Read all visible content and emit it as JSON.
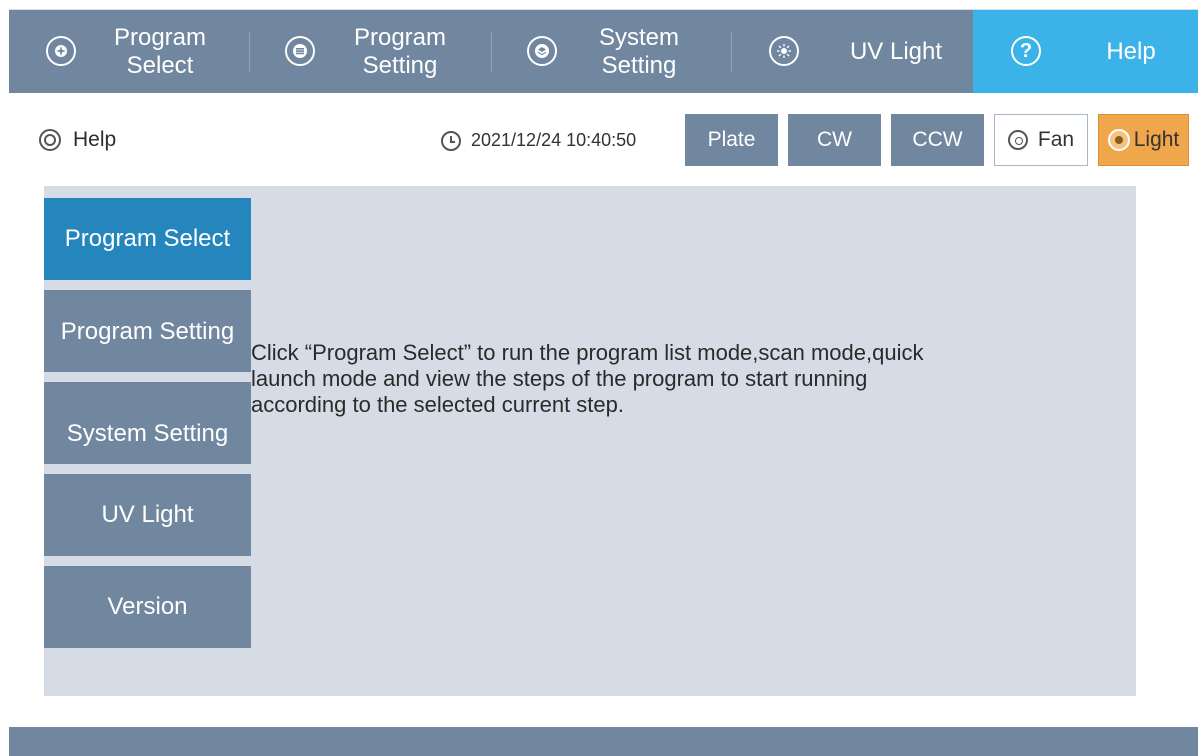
{
  "nav": {
    "items": [
      {
        "line1": "Program",
        "line2": "Select",
        "icon": "compass-icon"
      },
      {
        "line1": "Program",
        "line2": "Setting",
        "icon": "list-icon"
      },
      {
        "line1": "System",
        "line2": "Setting",
        "icon": "layers-icon"
      },
      {
        "label": "UV Light",
        "icon": "sun-icon"
      },
      {
        "label": "Help",
        "icon": "question-icon",
        "active": true
      }
    ]
  },
  "header": {
    "title": "Help",
    "datetime": "2021/12/24 10:40:50",
    "buttons": {
      "plate": "Plate",
      "cw": "CW",
      "ccw": "CCW",
      "fan": "Fan",
      "light": "Light"
    }
  },
  "sidebar": {
    "items": [
      {
        "label": "Program Select",
        "active": true
      },
      {
        "label": "Program Setting"
      },
      {
        "label": "System Setting"
      },
      {
        "label": "UV Light"
      },
      {
        "label": "Version"
      }
    ]
  },
  "content": {
    "line1": "Click “Program Select” to run the program list mode,scan mode,quick",
    "line2": "launch mode and view the steps of the program to start running",
    "line3": "according to the selected current step."
  },
  "colors": {
    "nav_bg": "#71869f",
    "nav_active": "#3bb3e8",
    "sidebar_active": "#2585bd",
    "light_button": "#f0a64a",
    "panel_bg": "#d6dce5"
  }
}
